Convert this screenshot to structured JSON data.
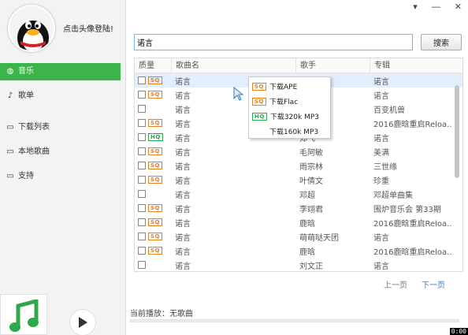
{
  "profile": {
    "login_text": "点击头像登陆!"
  },
  "window": {
    "min_symbol": "―",
    "pin_symbol": "▾",
    "close_symbol": "✕"
  },
  "nav": [
    {
      "label": "音乐",
      "icon": "music-disc-icon",
      "active": true
    },
    {
      "label": "歌单",
      "icon": "playlist-icon",
      "active": false
    },
    {
      "label": "下载列表",
      "icon": "monitor-icon",
      "active": false
    },
    {
      "label": "本地歌曲",
      "icon": "monitor-icon",
      "active": false
    },
    {
      "label": "支持",
      "icon": "monitor-icon",
      "active": false
    }
  ],
  "search": {
    "value": "诺言",
    "button_label": "搜索"
  },
  "table": {
    "headers": [
      "质量",
      "歌曲名",
      "歌手",
      "专辑"
    ],
    "rows": [
      {
        "badge": "SQ",
        "name": "诺言",
        "artist": "",
        "album": "诺言"
      },
      {
        "badge": "SQ",
        "name": "诺言",
        "artist": "",
        "album": "诺言"
      },
      {
        "badge": "",
        "name": "诺言",
        "artist": "",
        "album": "百变机兽"
      },
      {
        "badge": "SQ",
        "name": "诺言",
        "artist": "",
        "album": "2016鹿晗重启Reloa..."
      },
      {
        "badge": "HQ",
        "name": "诺言",
        "artist": "郑飞",
        "album": "诺言"
      },
      {
        "badge": "SQ",
        "name": "诺言",
        "artist": "毛阿敏",
        "album": "美满"
      },
      {
        "badge": "SQ",
        "name": "诺言",
        "artist": "雨宗林",
        "album": "三世缘"
      },
      {
        "badge": "SQ",
        "name": "诺言",
        "artist": "叶倩文",
        "album": "珍重"
      },
      {
        "badge": "",
        "name": "诺言",
        "artist": "邓超",
        "album": "邓超单曲集"
      },
      {
        "badge": "SQ",
        "name": "诺言",
        "artist": "李翊君",
        "album": "围炉音乐会 第33期"
      },
      {
        "badge": "SQ",
        "name": "诺言",
        "artist": "鹿晗",
        "album": "2016鹿晗重启Reloa..."
      },
      {
        "badge": "SQ",
        "name": "诺言",
        "artist": "萌萌哒天团",
        "album": "诺言"
      },
      {
        "badge": "SQ",
        "name": "诺言",
        "artist": "鹿晗",
        "album": "2016鹿晗重启Reloa..."
      },
      {
        "badge": "",
        "name": "诺言",
        "artist": "刘文正",
        "album": "诺言"
      }
    ]
  },
  "context_menu": [
    {
      "badge": "SQ",
      "label": "下载APE"
    },
    {
      "badge": "SQ",
      "label": "下载Flac"
    },
    {
      "badge": "HQ",
      "label": "下载320k MP3"
    },
    {
      "badge": "",
      "label": "下载160k MP3"
    }
  ],
  "pager": {
    "prev": "上一页",
    "next": "下一页"
  },
  "player": {
    "now_playing": "当前播放：无歌曲",
    "time": "0:00"
  },
  "colors": {
    "accent": "#3db44a",
    "sq": "#e8801a",
    "hq": "#27a84a",
    "link": "#2b82d9",
    "selected_row": "#e2eefc"
  }
}
